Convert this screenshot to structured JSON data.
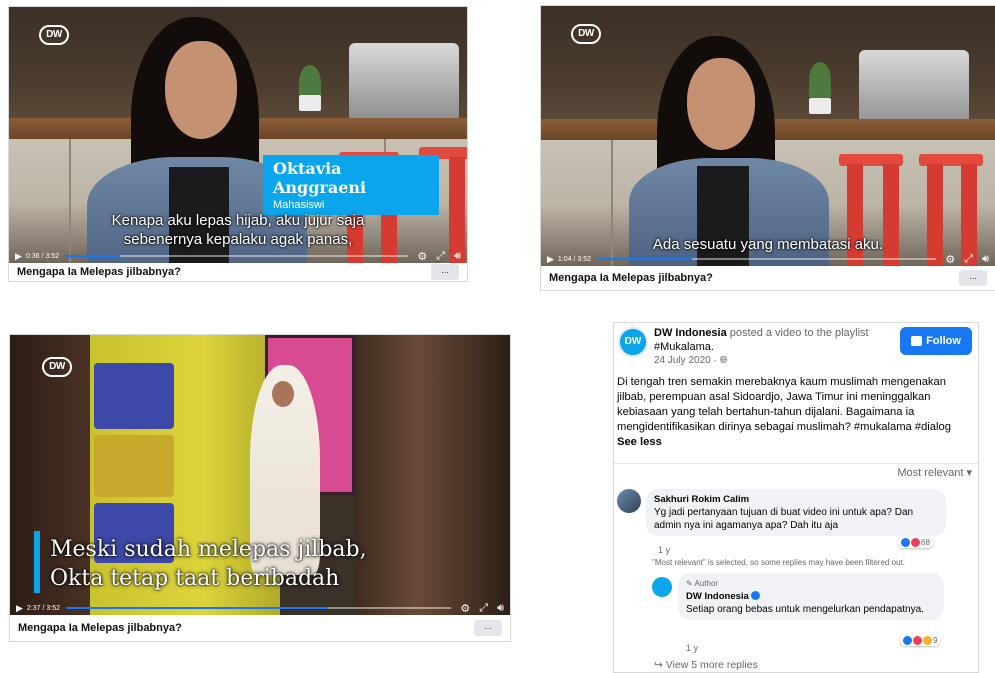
{
  "videos": [
    {
      "title": "Mengapa Ia Melepas jilbabnya?",
      "name_tag": {
        "name": "Oktavia Anggraeni",
        "role": "Mahasiswi"
      },
      "subtitle_lines": [
        "Kenapa aku lepas hijab, aku jujur saja",
        "sebenernya kepalaku agak panas,"
      ],
      "time": "0:36 / 3:52",
      "progress": 0.16,
      "more_label": "..."
    },
    {
      "title": "Mengapa Ia Melepas jilbabnya?",
      "subtitle_lines": [
        "Ada sesuatu yang membatasi aku."
      ],
      "time": "1:04 / 3:52",
      "progress": 0.28,
      "more_label": "..."
    },
    {
      "title": "Mengapa Ia Melepas jilbabnya?",
      "subtitle_lines": [
        "Meski sudah melepas jilbab,",
        "Okta tetap taat beribadah"
      ],
      "time": "2:37 / 3:52",
      "progress": 0.68,
      "more_label": "..."
    }
  ],
  "logo_text": "DW",
  "post": {
    "page_name": "DW Indonesia",
    "action": "posted a video to the playlist",
    "playlist": "#Mukalama.",
    "date": "24 July 2020 · ",
    "follow_label": "Follow",
    "body": "Di tengah tren semakin merebaknya kaum muslimah mengenakan jilbab, perempuan asal Sidoardjo, Jawa Timur ini meninggalkan kebiasaan yang telah bertahun-tahun dijalani. Bagaimana ia mengidentifikasikan dirinya sebagai muslimah? #mukalama #dialog",
    "see_less": "See less",
    "sort_label": "Most relevant ▾",
    "comment": {
      "author": "Sakhuri Rokim Calim",
      "text": "Yg jadi pertanyaan tujuan di buat video ini untuk apa? Dan admin nya ini agamanya apa? Dah itu aja",
      "age": "1 y",
      "reaction_count": "68",
      "filter_note": "\"Most relevant\" is selected, so some replies may have been filtered out."
    },
    "reply": {
      "badge": "Author",
      "author": "DW Indonesia",
      "text": "Setiap orang bebas untuk mengelurkan pendapatnya.",
      "age": "1 y",
      "reaction_count": "9"
    },
    "view_more": "View 5 more replies"
  },
  "colors": {
    "facebook_blue": "#1877f2",
    "dw_accent": "#0aa5ea"
  }
}
